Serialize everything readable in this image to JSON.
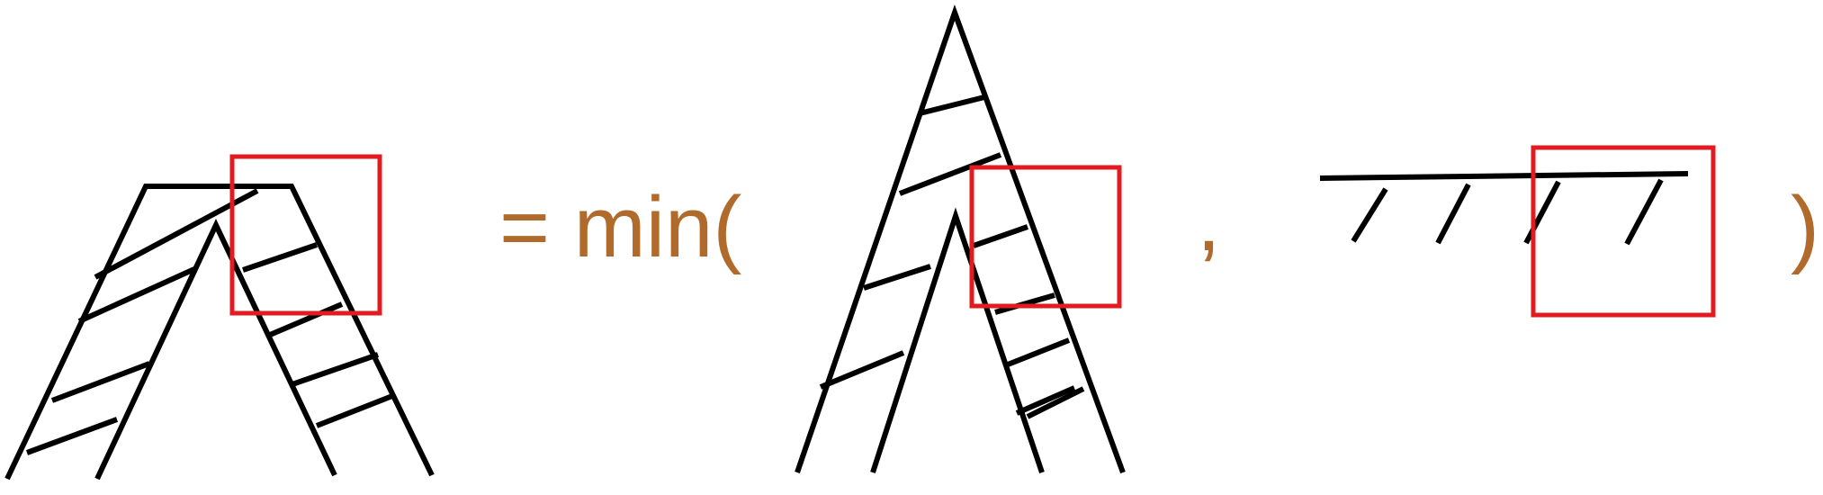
{
  "equation": {
    "equals_min": "= min(",
    "comma": ",",
    "close_paren": ")"
  },
  "colors": {
    "text": "#b06a2c",
    "highlight": "#e21b23",
    "ink": "#000000"
  }
}
